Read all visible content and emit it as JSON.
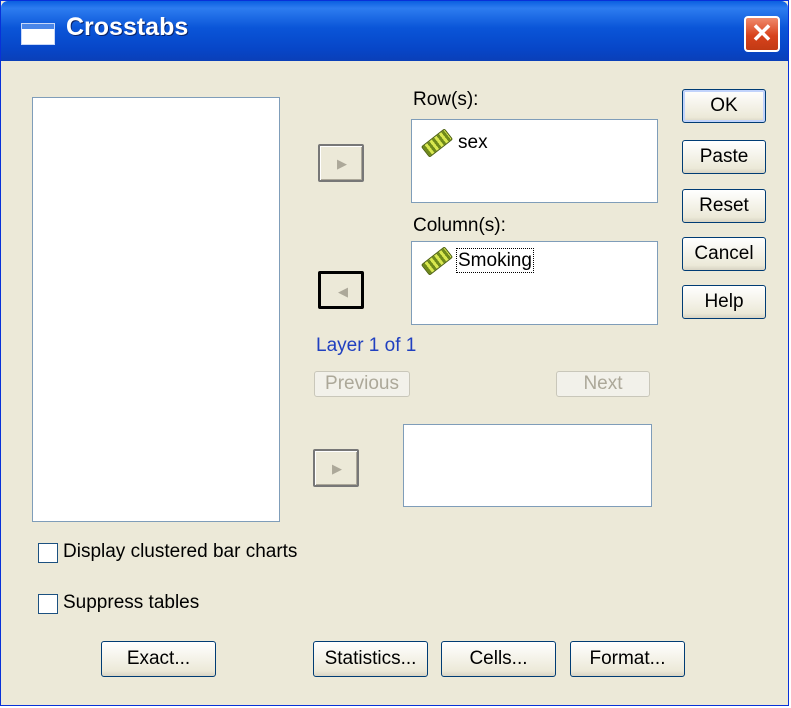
{
  "window": {
    "title": "Crosstabs",
    "close_glyph": "✕"
  },
  "rows": {
    "label": "Row(s):",
    "items": [
      "sex"
    ]
  },
  "columns": {
    "label": "Column(s):",
    "items": [
      "Smoking"
    ]
  },
  "layer": {
    "text": "Layer 1 of 1",
    "previous_label": "Previous",
    "next_label": "Next"
  },
  "buttons": {
    "ok": "OK",
    "paste": "Paste",
    "reset": "Reset",
    "cancel": "Cancel",
    "help": "Help"
  },
  "options": {
    "clustered_bar_charts": "Display clustered bar charts",
    "suppress_tables": "Suppress tables"
  },
  "bottom_buttons": {
    "exact": "Exact...",
    "statistics": "Statistics...",
    "cells": "Cells...",
    "format": "Format..."
  },
  "icons": {
    "arrow": "right-arrow-icon",
    "variable": "ruler-icon"
  }
}
